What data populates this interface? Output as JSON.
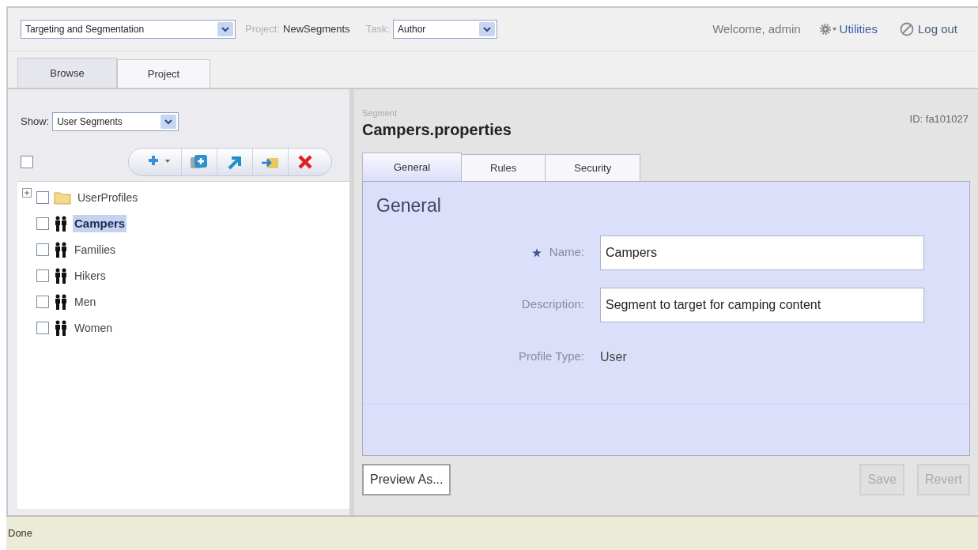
{
  "header": {
    "application": {
      "value": "Targeting and Segmentation"
    },
    "project": {
      "label": "Project:",
      "value": "NewSegments"
    },
    "task": {
      "label": "Task:",
      "value": "Author"
    },
    "welcome": "Welcome, admin",
    "utilities": "Utilities",
    "logout": "Log out"
  },
  "main_tabs": [
    {
      "label": "Browse",
      "selected": true
    },
    {
      "label": "Project",
      "selected": false
    }
  ],
  "browser": {
    "show": {
      "label": "Show:",
      "value": "User Segments"
    },
    "select_all": {
      "checked": false
    },
    "toolbar": [
      {
        "kind": "add"
      },
      {
        "kind": "duplicate"
      },
      {
        "kind": "move"
      },
      {
        "kind": "import"
      },
      {
        "kind": "delete"
      }
    ],
    "tree": [
      {
        "kind": "folder",
        "label": "UserProfiles",
        "expanded": false,
        "checked": false,
        "selected": false
      },
      {
        "kind": "segment",
        "label": "Campers",
        "checked": false,
        "selected": true
      },
      {
        "kind": "segment",
        "label": "Families",
        "checked": false,
        "selected": false
      },
      {
        "kind": "segment",
        "label": "Hikers",
        "checked": false,
        "selected": false
      },
      {
        "kind": "segment",
        "label": "Men",
        "checked": false,
        "selected": false
      },
      {
        "kind": "segment",
        "label": "Women",
        "checked": false,
        "selected": false
      }
    ]
  },
  "detail": {
    "type": "Segment",
    "title": "Campers.properties",
    "id": "ID: fa101027",
    "tabs": [
      {
        "label": "General",
        "selected": true
      },
      {
        "label": "Rules",
        "selected": false
      },
      {
        "label": "Security",
        "selected": false
      }
    ],
    "section": "General",
    "fields": [
      {
        "kind": "input",
        "required": true,
        "label": "Name:",
        "value": "Campers"
      },
      {
        "kind": "input",
        "required": false,
        "label": "Description:",
        "value": "Segment to target for camping content"
      },
      {
        "kind": "text",
        "required": false,
        "label": "Profile Type:",
        "value": "User"
      }
    ],
    "buttons": [
      {
        "label": "Preview As...",
        "disabled": false
      },
      {
        "label": "Save",
        "disabled": true
      },
      {
        "label": "Revert",
        "disabled": true
      }
    ]
  },
  "status_bar": "Done"
}
